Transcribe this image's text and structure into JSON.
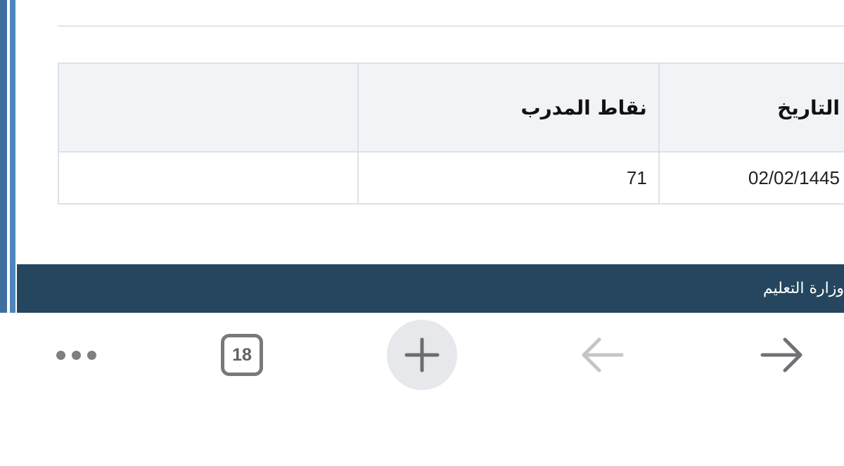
{
  "table": {
    "headers": [
      "التاريخ",
      "نقاط المدرب",
      ""
    ],
    "rows": [
      [
        "02/02/1445",
        "71",
        ""
      ]
    ]
  },
  "footer": {
    "text": "وزارة التعليم"
  },
  "toolbar": {
    "tab_count": "18",
    "icons": {
      "more": "ellipsis-icon",
      "tabs": "tab-switcher-icon",
      "new_tab": "plus-icon",
      "back": "arrow-left-icon",
      "forward": "arrow-right-icon"
    },
    "back_enabled": false,
    "forward_enabled": true
  },
  "colors": {
    "footer_band": "#25465e",
    "left_accent": "#4f84bb",
    "table_header_bg": "#f2f3f7",
    "toolbar_icon": "#77797c"
  }
}
